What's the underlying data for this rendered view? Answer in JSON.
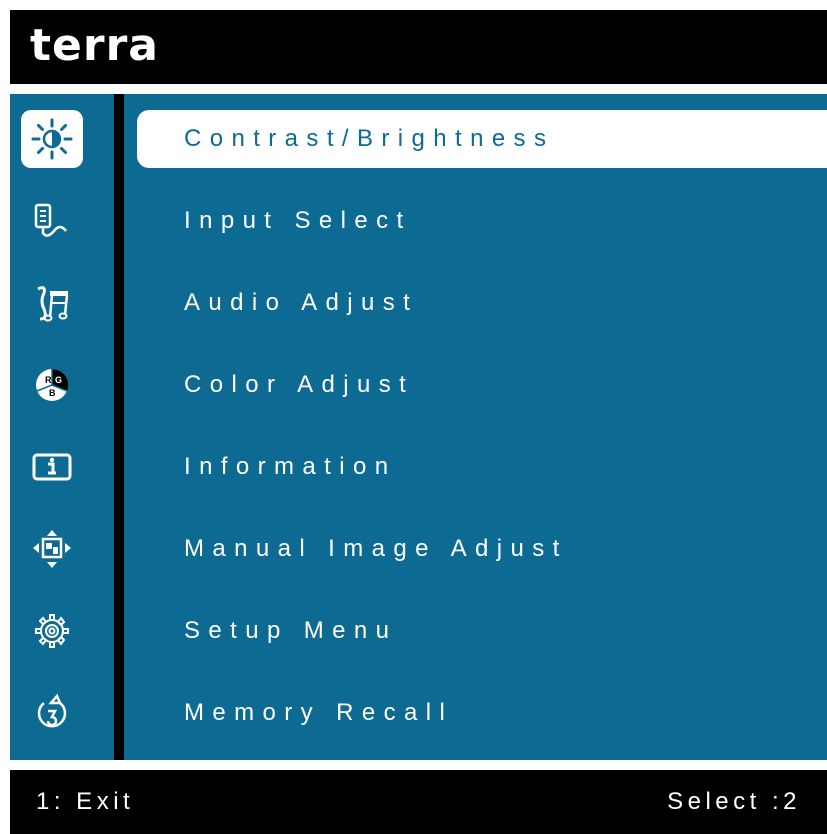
{
  "header": {
    "brand": "terra"
  },
  "colors": {
    "accent": "#0d6b93",
    "highlight": "#ffffff",
    "frame": "#000000"
  },
  "menu": {
    "items": [
      {
        "label": "Contrast/Brightness",
        "icon": "brightness-icon",
        "selected": true
      },
      {
        "label": "Input Select",
        "icon": "input-select-icon",
        "selected": false
      },
      {
        "label": "Audio Adjust",
        "icon": "audio-icon",
        "selected": false
      },
      {
        "label": "Color Adjust",
        "icon": "rgb-color-icon",
        "selected": false
      },
      {
        "label": "Information",
        "icon": "info-icon",
        "selected": false
      },
      {
        "label": "Manual Image Adjust",
        "icon": "image-adjust-icon",
        "selected": false
      },
      {
        "label": "Setup Menu",
        "icon": "gear-icon",
        "selected": false
      },
      {
        "label": "Memory Recall",
        "icon": "recall-icon",
        "selected": false
      }
    ]
  },
  "footer": {
    "exit_label": "1: Exit",
    "select_label": "Select :2"
  }
}
